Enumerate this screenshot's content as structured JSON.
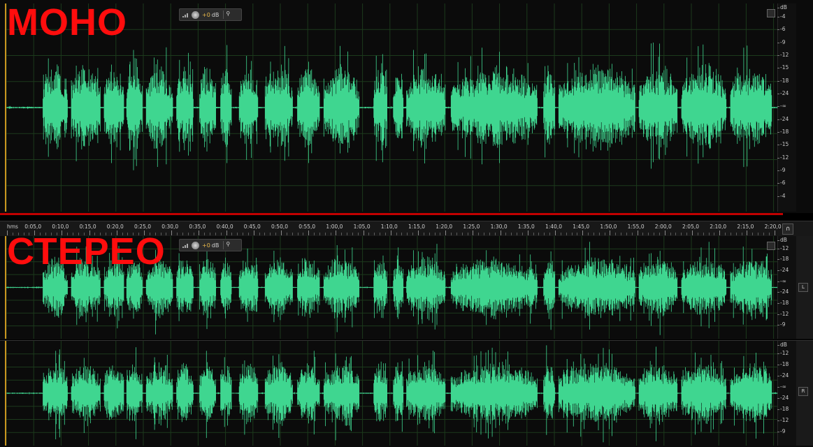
{
  "labels": {
    "mono": "МОНО",
    "stereo": "СТЕРЕО"
  },
  "hud": {
    "gain": "+0",
    "unit": "dB"
  },
  "ruler": {
    "unit": "hms",
    "marks": [
      "0:05,0",
      "0:10,0",
      "0:15,0",
      "0:20,0",
      "0:25,0",
      "0:30,0",
      "0:35,0",
      "0:40,0",
      "0:45,0",
      "0:50,0",
      "0:55,0",
      "1:00,0",
      "1:05,0",
      "1:10,0",
      "1:15,0",
      "1:20,0",
      "1:25,0",
      "1:30,0",
      "1:35,0",
      "1:40,0",
      "1:45,0",
      "1:50,0",
      "1:55,0",
      "2:00,0",
      "2:05,0",
      "2:10,0",
      "2:15,0",
      "2:20,0"
    ]
  },
  "mono_scale": [
    "dB",
    "-4",
    "-6",
    "-9",
    "-12",
    "-15",
    "-18",
    "-24",
    "-∞",
    "-24",
    "-18",
    "-15",
    "-12",
    "-9",
    "-6",
    "-4"
  ],
  "left_scale": [
    "dB",
    "-12",
    "-18",
    "-24",
    "-∞",
    "-24",
    "-18",
    "-12",
    "-9"
  ],
  "right_scale": [
    "dB",
    "-12",
    "-18",
    "-24",
    "-∞",
    "-24",
    "-18",
    "-12",
    "-9"
  ],
  "channels": {
    "left": "L",
    "right": "R"
  },
  "colors": {
    "waveform": "#3fd690",
    "label": "#ff0d0d",
    "divider": "#c00000",
    "gain": "#e8b84a"
  },
  "icons": [
    "signal-bars-icon",
    "volume-knob-icon",
    "pin-icon",
    "headphones-icon",
    "zoom-corner-icon"
  ]
}
